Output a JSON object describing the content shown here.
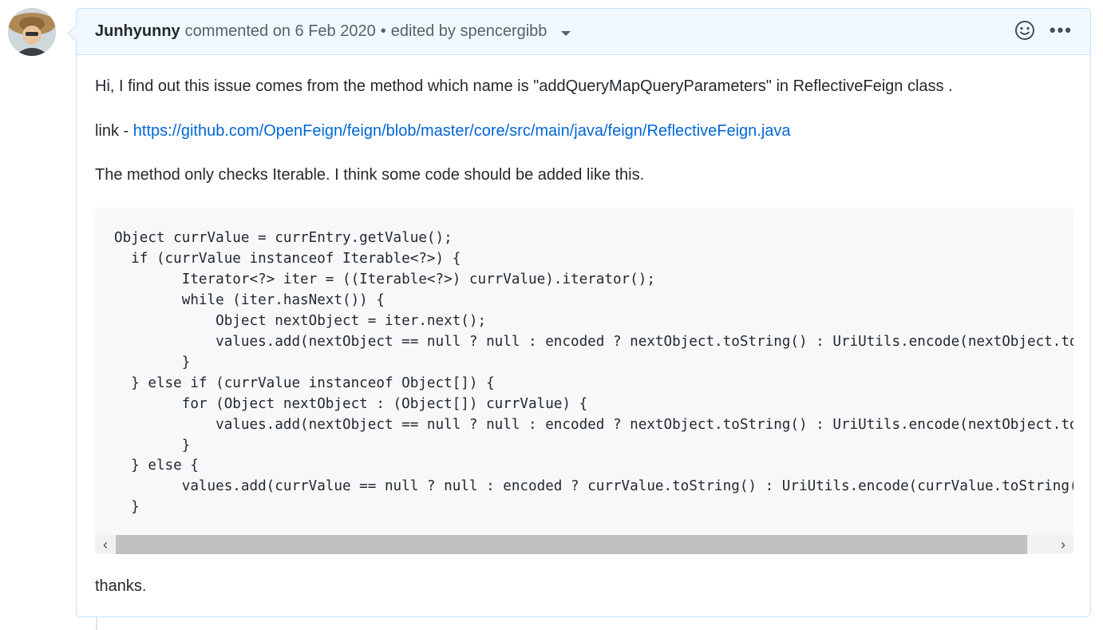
{
  "comment": {
    "author": "Junhyunny",
    "action": "commented on 6 Feb 2020",
    "separator": "•",
    "edited": "edited by spencergibb",
    "icons": {
      "reaction": "smiley-icon",
      "menu": "more-horizontal-icon",
      "caret": "chevron-down-icon"
    },
    "body": {
      "p1": "Hi, I find out this issue comes from the method which name is \"addQueryMapQueryParameters\" in ReflectiveFeign class .",
      "link_prefix": "link - ",
      "link_text": "https://github.com/OpenFeign/feign/blob/master/core/src/main/java/feign/ReflectiveFeign.java",
      "p3": "The method only checks Iterable. I think some code should be added like this.",
      "code": [
        "Object currValue = currEntry.getValue();",
        "  if (currValue instanceof Iterable<?>) {",
        "        Iterator<?> iter = ((Iterable<?>) currValue).iterator();",
        "        while (iter.hasNext()) {",
        "            Object nextObject = iter.next();",
        "            values.add(nextObject == null ? null : encoded ? nextObject.toString() : UriUtils.encode(nextObject.toString()",
        "        }",
        "  } else if (currValue instanceof Object[]) {",
        "        for (Object nextObject : (Object[]) currValue) {",
        "            values.add(nextObject == null ? null : encoded ? nextObject.toString() : UriUtils.encode(nextObject.toString()",
        "        }",
        "  } else {",
        "        values.add(currValue == null ? null : encoded ? currValue.toString() : UriUtils.encode(currValue.toString()));",
        "  }"
      ],
      "closing": "thanks."
    },
    "scrollbar": {
      "left_arrow": "‹",
      "right_arrow": "›"
    },
    "colors": {
      "header_bg": "#f1f8ff",
      "border": "#c8e1ff",
      "link": "#0366d6",
      "code_bg": "#f6f8fa"
    }
  }
}
